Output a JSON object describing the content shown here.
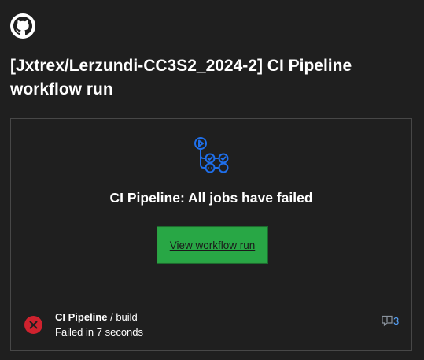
{
  "header": {
    "logo_icon": "github-mark-icon",
    "title": "[Jxtrex/Lerzundi-CC3S2_2024-2] CI Pipeline workflow run"
  },
  "card": {
    "icon": "github-actions-workflow-icon",
    "heading": "CI Pipeline: All jobs have failed",
    "button_label": "View workflow run",
    "job": {
      "status_icon": "failed-x-icon",
      "name": "CI Pipeline",
      "separator": " / ",
      "job_name": "build",
      "status_text": "Failed in 7 seconds",
      "comment_icon": "comment-icon",
      "comment_count": "3"
    }
  },
  "colors": {
    "background": "#1f1f1f",
    "button": "#28a745",
    "failure": "#cf222e",
    "link": "#58a6ff",
    "actions_blue": "#1f6feb"
  }
}
